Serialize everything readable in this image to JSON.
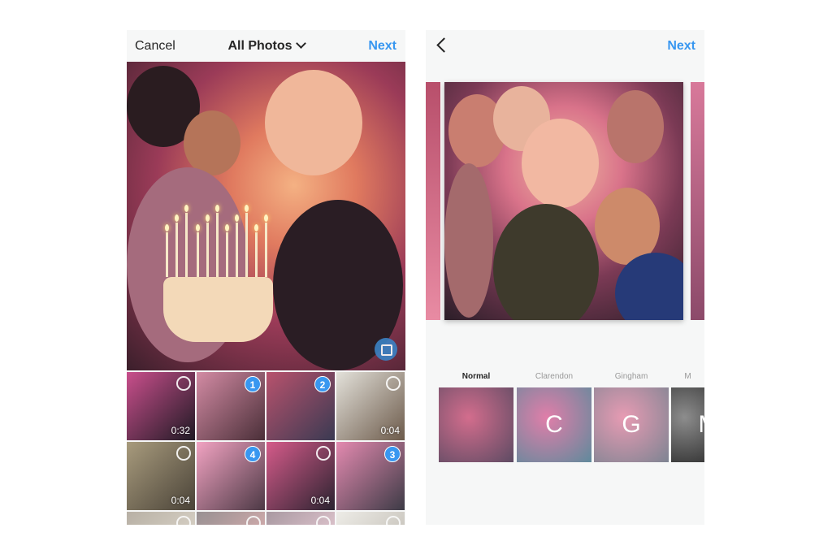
{
  "left": {
    "header": {
      "cancel": "Cancel",
      "title": "All Photos",
      "next": "Next"
    },
    "grid": [
      {
        "index": "",
        "duration": "0:32",
        "colors": [
          "#c94f8c",
          "#1f1a24"
        ]
      },
      {
        "index": "1",
        "duration": "",
        "colors": [
          "#d38ba4",
          "#4a2f38"
        ]
      },
      {
        "index": "2",
        "duration": "",
        "colors": [
          "#b8526d",
          "#3a3a52"
        ]
      },
      {
        "index": "",
        "duration": "0:04",
        "colors": [
          "#e3e1da",
          "#6d5b4b"
        ]
      },
      {
        "index": "",
        "duration": "0:04",
        "colors": [
          "#a89b7d",
          "#4a4338"
        ]
      },
      {
        "index": "4",
        "duration": "",
        "colors": [
          "#f2a3c2",
          "#4c3945"
        ]
      },
      {
        "index": "",
        "duration": "0:04",
        "colors": [
          "#d55b8a",
          "#2b2330"
        ]
      },
      {
        "index": "3",
        "duration": "",
        "colors": [
          "#e48ab0",
          "#3d3b46"
        ]
      },
      {
        "index": "",
        "duration": "",
        "colors": [
          "#7a6b55",
          "#c7b9a2"
        ]
      },
      {
        "index": "",
        "duration": "",
        "colors": [
          "#3a2a2e",
          "#c96f6f"
        ]
      },
      {
        "index": "",
        "duration": "",
        "colors": [
          "#5b3a4b",
          "#e0a6b8"
        ]
      },
      {
        "index": "",
        "duration": "",
        "colors": [
          "#e6e2d8",
          "#8d8372"
        ]
      }
    ]
  },
  "right": {
    "header": {
      "next": "Next"
    },
    "filters": [
      {
        "label": "Normal",
        "letter": "",
        "colors": [
          "#d36d8d",
          "#5d4b63"
        ]
      },
      {
        "label": "Clarendon",
        "letter": "C",
        "colors": [
          "#e07ea9",
          "#5f8a9c"
        ]
      },
      {
        "label": "Gingham",
        "letter": "G",
        "colors": [
          "#e79bb3",
          "#7d8492"
        ]
      },
      {
        "label": "M",
        "letter": "M",
        "colors": [
          "#8d8d8d",
          "#3a3a3a"
        ]
      }
    ]
  }
}
